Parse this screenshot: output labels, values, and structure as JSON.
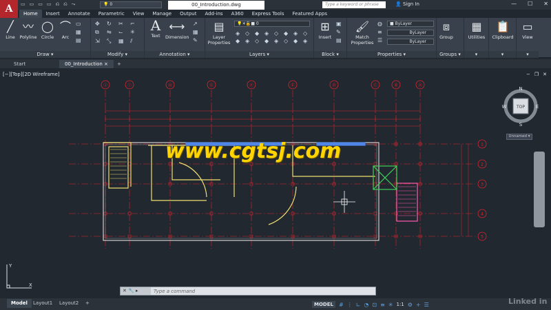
{
  "app": {
    "logo_letter": "A",
    "file_title": "00_Introduction.dwg",
    "search_placeholder": "Type a keyword or phrase",
    "sign_in": "Sign In",
    "layer_quick": "0",
    "win_min": "—",
    "win_max": "☐",
    "win_close": "✕"
  },
  "qat_icons": [
    "▭",
    "▭",
    "▭",
    "▭",
    "⎌",
    "⎌",
    "⤳"
  ],
  "ribbon_tabs": [
    {
      "label": "Home",
      "active": true
    },
    {
      "label": "Insert"
    },
    {
      "label": "Annotate"
    },
    {
      "label": "Parametric"
    },
    {
      "label": "View"
    },
    {
      "label": "Manage"
    },
    {
      "label": "Output"
    },
    {
      "label": "Add-ins"
    },
    {
      "label": "A360"
    },
    {
      "label": "Express Tools"
    },
    {
      "label": "Featured Apps"
    }
  ],
  "ribbon": {
    "draw": {
      "title": "Draw ▾",
      "line": "Line",
      "polyline": "Polyline",
      "circle": "Circle",
      "arc": "Arc"
    },
    "modify": {
      "title": "Modify ▾"
    },
    "annotation": {
      "title": "Annotation ▾",
      "text": "Text",
      "dimension": "Dimension"
    },
    "layers": {
      "title": "Layers ▾",
      "properties": "Layer\nProperties",
      "current": "0"
    },
    "block": {
      "title": "Block ▾",
      "insert": "Insert"
    },
    "properties": {
      "title": "Properties ▾",
      "match": "Match\nProperties",
      "color": "ByLayer",
      "linetype": "ByLayer",
      "lineweight": "ByLayer"
    },
    "groups": {
      "title": "Groups ▾",
      "group": "Group"
    },
    "utilities": "Utilities",
    "clipboard": "Clipboard",
    "view": "View"
  },
  "doc_tabs": [
    {
      "label": "Start"
    },
    {
      "label": "00_Introduction",
      "active": true,
      "close": "×"
    },
    {
      "label": "+"
    }
  ],
  "viewport": {
    "label": "[−][Top][2D Wireframe]",
    "ctrl_min": "−",
    "ctrl_max": "❐",
    "ctrl_close": "✕",
    "watermark": "www.cgtsj.com",
    "viewcube": {
      "n": "N",
      "s": "S",
      "e": "E",
      "w": "W",
      "top": "TOP"
    },
    "unnamed": "Unnamed ▾",
    "ucs_x": "X",
    "ucs_y": "Y"
  },
  "grid_columns": [
    "Ⓐ",
    "Ⓑ",
    "Ⓒ",
    "Ⓓ",
    "Ⓔ",
    "Ⓕ",
    "Ⓖ",
    "Ⓗ",
    "Ⓘ",
    "Ⓙ"
  ],
  "grid_rows": [
    "1",
    "2",
    "3",
    "4",
    "5"
  ],
  "command": {
    "placeholder": "Type a command",
    "icons": "✕ 🔧 ▸"
  },
  "layout_tabs": [
    {
      "label": "Model",
      "active": true
    },
    {
      "label": "Layout1"
    },
    {
      "label": "Layout2"
    },
    {
      "label": "+"
    }
  ],
  "status": {
    "model": "MODEL",
    "scale": "1:1"
  },
  "brand": "Linked in",
  "colors": {
    "grid_red": "#e0222c",
    "wall_yellow": "#f0e070",
    "wall_gray": "#d8d8d8",
    "accent_green": "#3fd25a",
    "accent_blue": "#4f86e8"
  }
}
